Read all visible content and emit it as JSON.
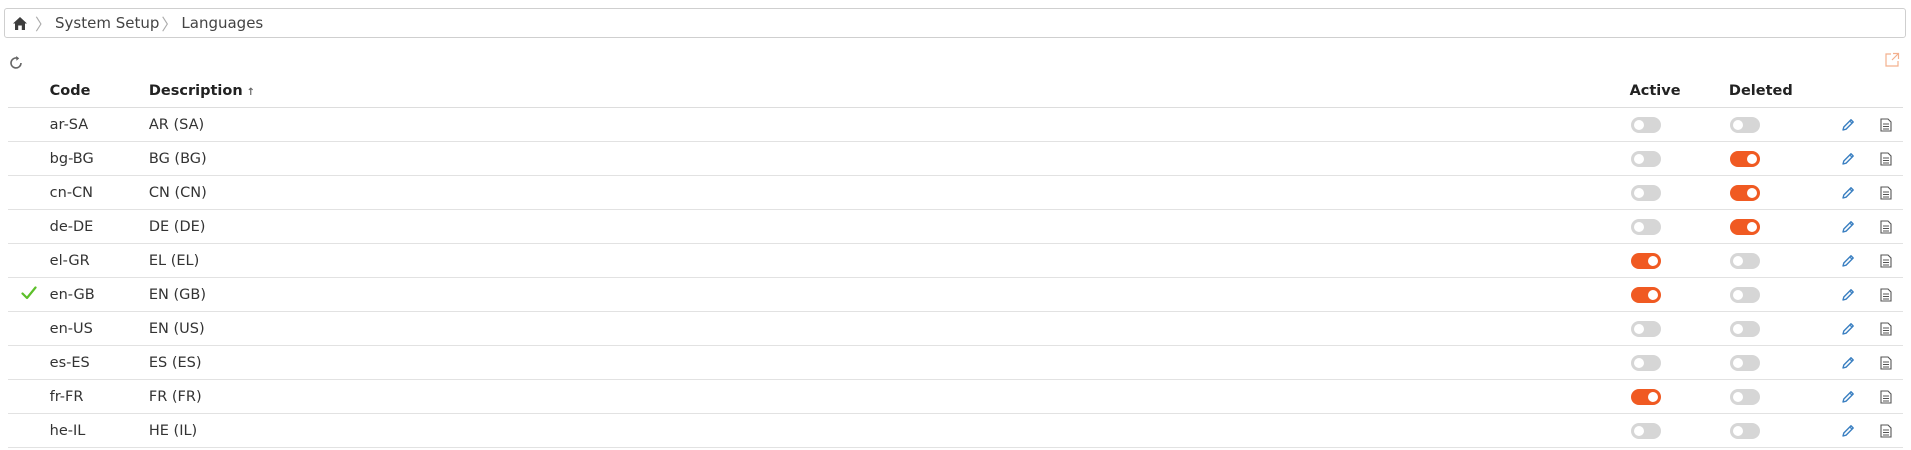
{
  "breadcrumb": {
    "home_icon": "home-icon",
    "items": [
      "System Setup",
      "Languages"
    ]
  },
  "toolbar": {
    "refresh_icon": "refresh-icon",
    "export_icon": "export-icon"
  },
  "colors": {
    "toggle_on": "#f05a22",
    "toggle_off": "#d6d6d6",
    "check": "#5cbf2a",
    "edit_icon": "#3a7fc1"
  },
  "table": {
    "columns": {
      "code": "Code",
      "description": "Description",
      "sort_indicator": "↑",
      "active": "Active",
      "deleted": "Deleted"
    },
    "rows": [
      {
        "code": "ar-SA",
        "description": "AR (SA)",
        "active": false,
        "deleted": false,
        "default": false
      },
      {
        "code": "bg-BG",
        "description": "BG (BG)",
        "active": false,
        "deleted": true,
        "default": false
      },
      {
        "code": "cn-CN",
        "description": "CN (CN)",
        "active": false,
        "deleted": true,
        "default": false
      },
      {
        "code": "de-DE",
        "description": "DE (DE)",
        "active": false,
        "deleted": true,
        "default": false
      },
      {
        "code": "el-GR",
        "description": "EL (EL)",
        "active": true,
        "deleted": false,
        "default": false
      },
      {
        "code": "en-GB",
        "description": "EN (GB)",
        "active": true,
        "deleted": false,
        "default": true
      },
      {
        "code": "en-US",
        "description": "EN (US)",
        "active": false,
        "deleted": false,
        "default": false
      },
      {
        "code": "es-ES",
        "description": "ES (ES)",
        "active": false,
        "deleted": false,
        "default": false
      },
      {
        "code": "fr-FR",
        "description": "FR (FR)",
        "active": true,
        "deleted": false,
        "default": false
      },
      {
        "code": "he-IL",
        "description": "HE (IL)",
        "active": false,
        "deleted": false,
        "default": false
      }
    ]
  }
}
